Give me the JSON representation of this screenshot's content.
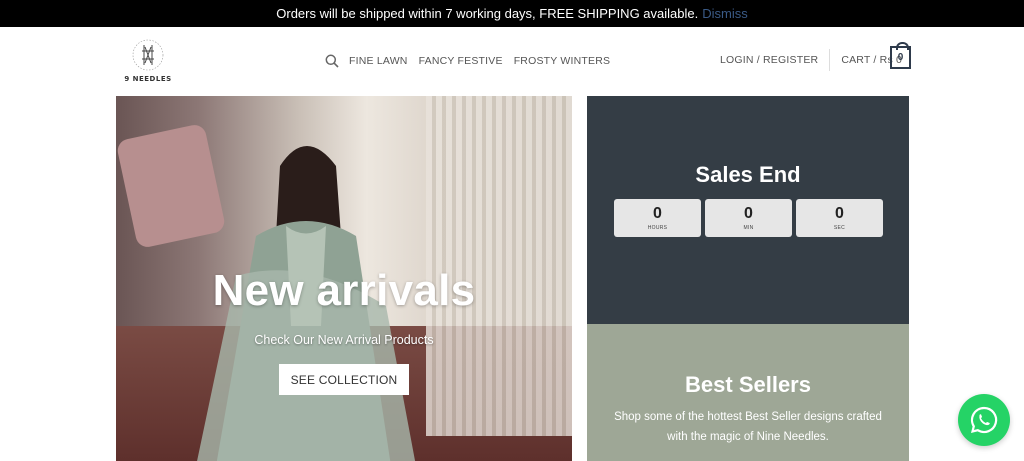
{
  "announcement": {
    "text": "Orders will be shipped within 7 working days, FREE SHIPPING available.",
    "dismiss_label": "Dismiss"
  },
  "header": {
    "logo_text": "9 NEEDLES",
    "nav": {
      "search_icon": "search-icon",
      "items": [
        {
          "label": "FINE LAWN"
        },
        {
          "label": "FANCY FESTIVE"
        },
        {
          "label": "FROSTY WINTERS"
        }
      ]
    },
    "account": {
      "login_label": "LOGIN / REGISTER",
      "cart_label": "CART / Rs 0",
      "cart_count": "0"
    }
  },
  "hero": {
    "title": "New arrivals",
    "subtitle": "Check Our New Arrival Products",
    "button_label": "SEE COLLECTION"
  },
  "sales_banner": {
    "title": "Sales End",
    "timer": [
      {
        "value": "0",
        "label": "HOURS"
      },
      {
        "value": "0",
        "label": "MIN"
      },
      {
        "value": "0",
        "label": "SEC"
      }
    ],
    "background": "#343d45"
  },
  "best_sellers": {
    "title": "Best Sellers",
    "description": "Shop some of the hottest Best Seller designs crafted with the magic of Nine Needles.",
    "background": "#9ea796"
  },
  "floating": {
    "whatsapp_icon": "whatsapp-icon",
    "color": "#25d366"
  }
}
